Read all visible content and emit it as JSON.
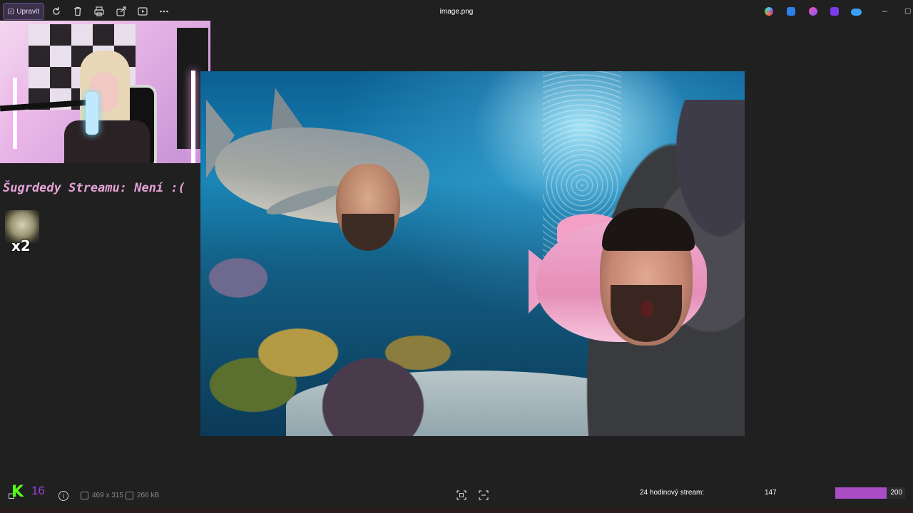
{
  "toolbar": {
    "edit_label": "Upravit",
    "title": "image.png"
  },
  "overlay": {
    "sugrdedy_text": "Šugrdedy Streamu: Není :(",
    "emote_count": "x2"
  },
  "bottom_bar": {
    "kick_logo": "K",
    "kick_count": "16",
    "dimensions": "469 x 315",
    "file_size": "266 kB"
  },
  "stream_goal": {
    "label": "24 hodinový stream:",
    "current": "147",
    "goal": "200",
    "progress": 0.735,
    "color": "#a84dc4"
  },
  "colors": {
    "accent": "#6a4f8f",
    "kick_green": "#53fc18",
    "overlay_pink": "#e6a3d9"
  }
}
